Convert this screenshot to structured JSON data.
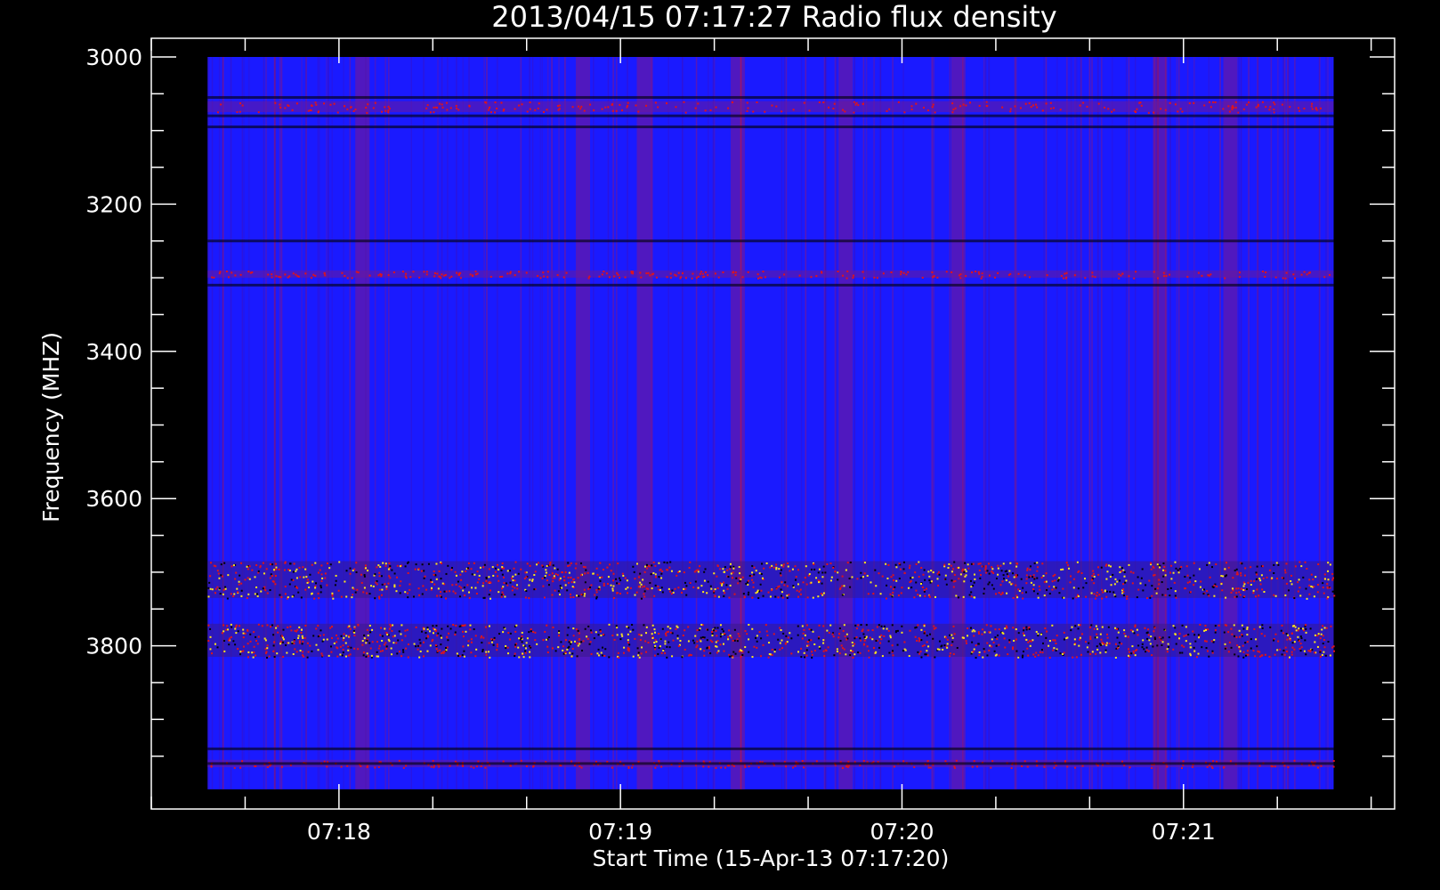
{
  "chart_data": {
    "type": "heatmap",
    "title": "2013/04/15 07:17:27 Radio flux density",
    "xlabel": "Start Time (15-Apr-13 07:17:20)",
    "ylabel": "Frequency (MHZ)",
    "x_range": [
      "07:17:20",
      "07:21:45"
    ],
    "y_range": [
      3000,
      4000
    ],
    "y_axis_reversed": true,
    "x_ticks": [
      "07:18",
      "07:19",
      "07:20",
      "07:21"
    ],
    "y_ticks": [
      3000,
      3200,
      3400,
      3600,
      3800
    ],
    "data_extent_x": [
      "07:17:32",
      "07:21:32"
    ],
    "data_extent_y": [
      3000,
      3995
    ],
    "background_color": "#1a1aff",
    "colors": {
      "low": "#000000",
      "base": "#1a1aff",
      "mid": "#e0141a",
      "high": "#ffe81a"
    },
    "bright_frequency_bands_mhz": [
      {
        "from": 3685,
        "to": 3735,
        "intensity": "high"
      },
      {
        "from": 3770,
        "to": 3815,
        "intensity": "high"
      },
      {
        "from": 3060,
        "to": 3075,
        "intensity": "medium"
      },
      {
        "from": 3290,
        "to": 3300,
        "intensity": "medium"
      },
      {
        "from": 3955,
        "to": 3965,
        "intensity": "medium"
      }
    ],
    "dark_frequency_lines_mhz": [
      3055,
      3080,
      3095,
      3250,
      3310,
      3940,
      3960
    ],
    "bright_time_columns": [
      "07:18:05",
      "07:18:52",
      "07:19:05",
      "07:19:25",
      "07:19:48",
      "07:20:12",
      "07:20:55",
      "07:21:10"
    ]
  }
}
